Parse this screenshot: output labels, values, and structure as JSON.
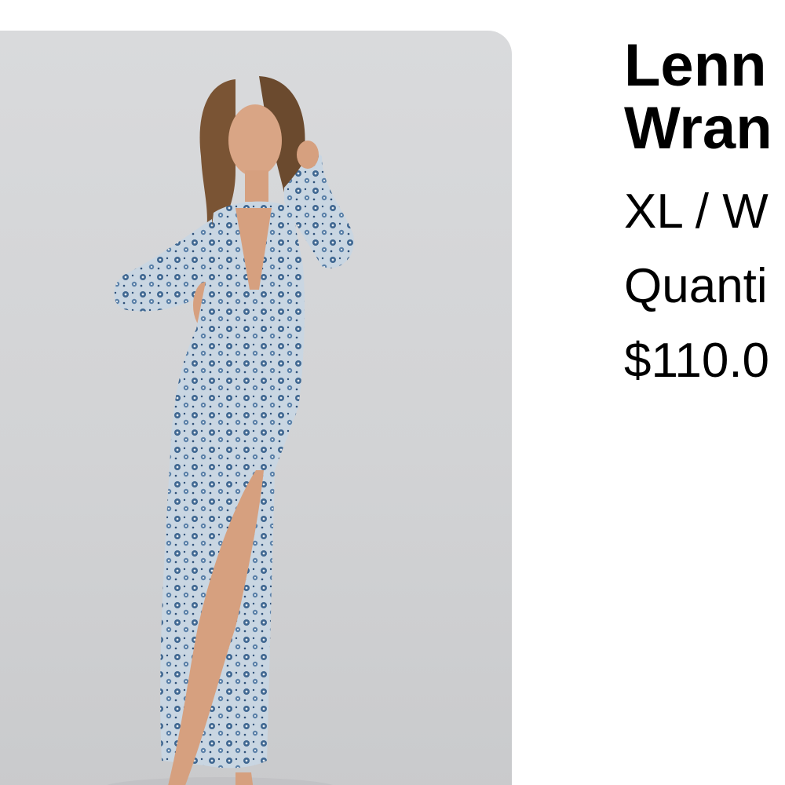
{
  "product": {
    "image_alt": "Model wearing a blue floral long-sleeve maxi dress",
    "title_line1": "Lenn",
    "title_line2": "Wran",
    "variant": "XL / W",
    "quantity_label": "Quanti",
    "price": "$110.0"
  },
  "colors": {
    "background": "#ffffff",
    "image_backdrop": "#d4d5d7",
    "dress_base": "#c7d4e0",
    "dress_print": "#3f6791",
    "text": "#000000"
  }
}
